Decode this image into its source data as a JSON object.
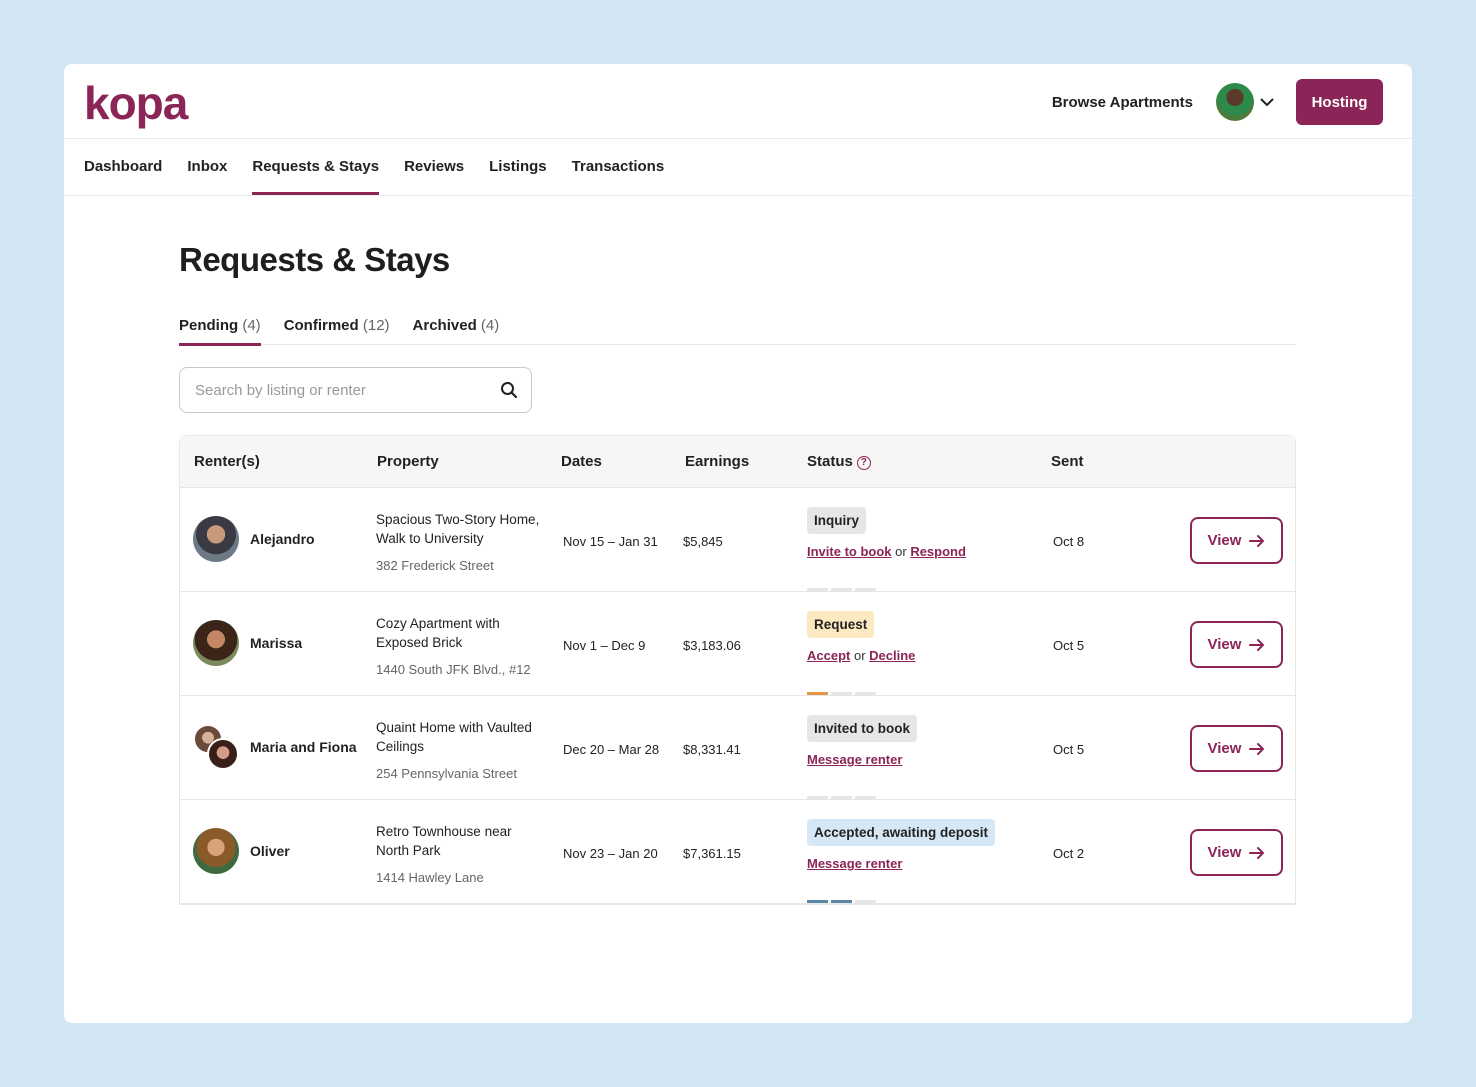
{
  "brand": {
    "logo": "kopa",
    "color": "#8b2557"
  },
  "header": {
    "browse_label": "Browse Apartments",
    "hosting_label": "Hosting",
    "chevron": "⌄"
  },
  "nav": {
    "items": [
      {
        "label": "Dashboard"
      },
      {
        "label": "Inbox"
      },
      {
        "label": "Requests & Stays",
        "active": true
      },
      {
        "label": "Reviews"
      },
      {
        "label": "Listings"
      },
      {
        "label": "Transactions"
      }
    ]
  },
  "page": {
    "title": "Requests & Stays"
  },
  "subtabs": [
    {
      "label": "Pending",
      "count": "(4)",
      "active": true
    },
    {
      "label": "Confirmed",
      "count": "(12)"
    },
    {
      "label": "Archived",
      "count": "(4)"
    }
  ],
  "search": {
    "placeholder": "Search by listing or renter",
    "value": ""
  },
  "table": {
    "headers": {
      "renters": "Renter(s)",
      "property": "Property",
      "dates": "Dates",
      "earnings": "Earnings",
      "status": "Status",
      "status_help": "?",
      "sent": "Sent"
    },
    "view_label": "View",
    "rows": [
      {
        "renter": "Alejandro",
        "property_title": "Spacious Two-Story Home, Walk to University",
        "property_address": "382 Frederick Street",
        "dates": "Nov 15 – Jan 31",
        "earnings": "$5,845",
        "status": "Inquiry",
        "action1": "Invite to book",
        "connector": "or",
        "action2": "Respond",
        "progress_steps": 0,
        "sent": "Oct 8"
      },
      {
        "renter": "Marissa",
        "property_title": "Cozy Apartment with Exposed Brick",
        "property_address": "1440 South JFK Blvd., #12",
        "dates": "Nov 1 – Dec 9",
        "earnings": "$3,183.06",
        "status": "Request",
        "action1": "Accept",
        "connector": "or",
        "action2": "Decline",
        "progress_steps": 1,
        "sent": "Oct 5"
      },
      {
        "renter": "Maria and Fiona",
        "property_title": "Quaint Home with Vaulted Ceilings",
        "property_address": "254 Pennsylvania Street",
        "dates": "Dec 20 – Mar 28",
        "earnings": "$8,331.41",
        "status": "Invited to book",
        "action1": "Message renter",
        "progress_steps": 0,
        "sent": "Oct 5"
      },
      {
        "renter": "Oliver",
        "property_title": "Retro Townhouse near North Park",
        "property_address": "1414 Hawley Lane",
        "dates": "Nov 23 – Jan 20",
        "earnings": "$7,361.15",
        "status": "Accepted, awaiting deposit",
        "action1": "Message renter",
        "progress_steps": 2,
        "sent": "Oct 2"
      }
    ]
  }
}
